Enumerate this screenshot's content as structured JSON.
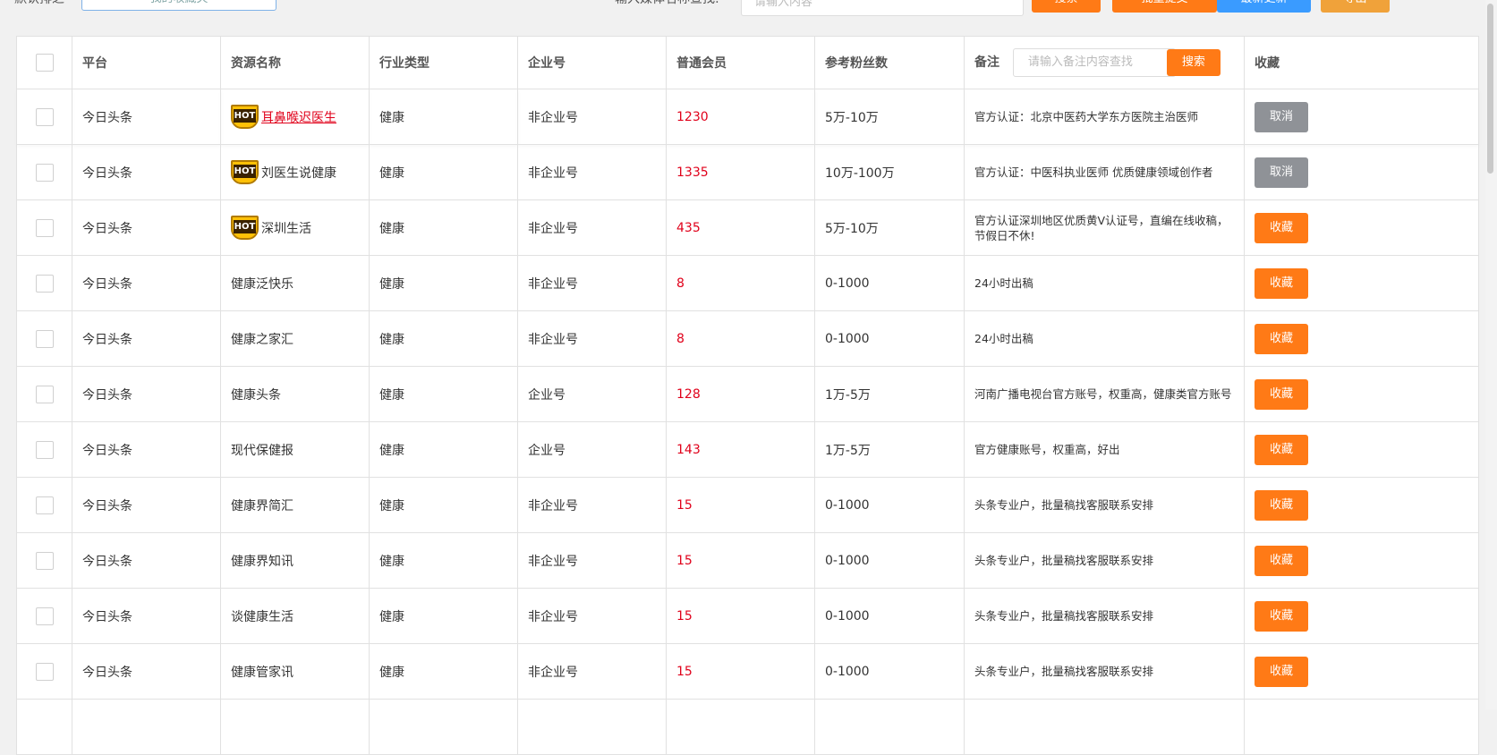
{
  "filters": {
    "label_left": "默认排之",
    "select_value": "我的收藏夹",
    "label_right": "输入媒体名称查找:",
    "search_placeholder": "请输入内容",
    "buttons": [
      "搜索",
      "批量提交",
      "最新更新",
      "导出"
    ]
  },
  "table": {
    "headers": {
      "platform": "平台",
      "name": "资源名称",
      "industry": "行业类型",
      "enterprise": "企业号",
      "member": "普通会员",
      "fans": "参考粉丝数",
      "note": "备注",
      "fav": "收藏"
    },
    "note_search": {
      "placeholder": "请输入备注内容查找",
      "button": "搜索"
    },
    "hot_label": "HOT",
    "rows": [
      {
        "platform": "今日头条",
        "name": "耳鼻喉迟医生",
        "hot": true,
        "industry": "健康",
        "enterprise": "非企业号",
        "member": "1230",
        "fans": "5万-10万",
        "note": "官方认证：北京中医药大学东方医院主治医师",
        "action": "取消"
      },
      {
        "platform": "今日头条",
        "name": "刘医生说健康",
        "hot": true,
        "industry": "健康",
        "enterprise": "非企业号",
        "member": "1335",
        "fans": "10万-100万",
        "note": "官方认证：中医科执业医师 优质健康领域创作者",
        "action": "取消"
      },
      {
        "platform": "今日头条",
        "name": "深圳生活",
        "hot": true,
        "industry": "健康",
        "enterprise": "非企业号",
        "member": "435",
        "fans": "5万-10万",
        "note": "官方认证深圳地区优质黄V认证号，直编在线收稿，节假日不休!",
        "action": "收藏"
      },
      {
        "platform": "今日头条",
        "name": "健康泛快乐",
        "hot": false,
        "industry": "健康",
        "enterprise": "非企业号",
        "member": "8",
        "fans": "0-1000",
        "note": "24小时出稿",
        "action": "收藏"
      },
      {
        "platform": "今日头条",
        "name": "健康之家汇",
        "hot": false,
        "industry": "健康",
        "enterprise": "非企业号",
        "member": "8",
        "fans": "0-1000",
        "note": "24小时出稿",
        "action": "收藏"
      },
      {
        "platform": "今日头条",
        "name": "健康头条",
        "hot": false,
        "industry": "健康",
        "enterprise": "企业号",
        "member": "128",
        "fans": "1万-5万",
        "note": "河南广播电视台官方账号，权重高，健康类官方账号",
        "action": "收藏"
      },
      {
        "platform": "今日头条",
        "name": "现代保健报",
        "hot": false,
        "industry": "健康",
        "enterprise": "企业号",
        "member": "143",
        "fans": "1万-5万",
        "note": "官方健康账号，权重高，好出",
        "action": "收藏"
      },
      {
        "platform": "今日头条",
        "name": "健康界简汇",
        "hot": false,
        "industry": "健康",
        "enterprise": "非企业号",
        "member": "15",
        "fans": "0-1000",
        "note": "头条专业户，批量稿找客服联系安排",
        "action": "收藏"
      },
      {
        "platform": "今日头条",
        "name": "健康界知讯",
        "hot": false,
        "industry": "健康",
        "enterprise": "非企业号",
        "member": "15",
        "fans": "0-1000",
        "note": "头条专业户，批量稿找客服联系安排",
        "action": "收藏"
      },
      {
        "platform": "今日头条",
        "name": "谈健康生活",
        "hot": false,
        "industry": "健康",
        "enterprise": "非企业号",
        "member": "15",
        "fans": "0-1000",
        "note": "头条专业户，批量稿找客服联系安排",
        "action": "收藏"
      },
      {
        "platform": "今日头条",
        "name": "健康管家讯",
        "hot": false,
        "industry": "健康",
        "enterprise": "非企业号",
        "member": "15",
        "fans": "0-1000",
        "note": "头条专业户，批量稿找客服联系安排",
        "action": "收藏"
      },
      {
        "platform": "",
        "name": "",
        "hot": false,
        "industry": "",
        "enterprise": "",
        "member": "",
        "fans": "",
        "note": "",
        "action": ""
      }
    ]
  },
  "colors": {
    "accent": "#ff7a16",
    "cancel": "#8f9297",
    "price": "#e0001a",
    "blue": "#3a9bff"
  }
}
